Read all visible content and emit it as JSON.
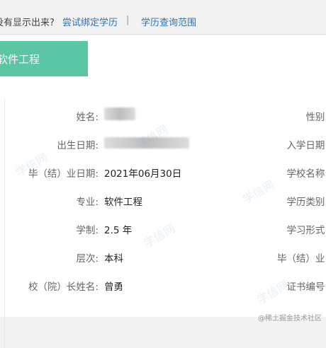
{
  "topbar": {
    "question": "没有显示出来?",
    "link_bind": "尝试绑定学历",
    "separator": "|",
    "link_query": "学历查询范围"
  },
  "tab": {
    "label": "软件工程"
  },
  "left_rows": [
    {
      "label": "姓名:",
      "value": ""
    },
    {
      "label": "出生日期:",
      "value": ""
    },
    {
      "label": "毕（结）业日期:",
      "value": "2021年06月30日"
    },
    {
      "label": "专业:",
      "value": "软件工程"
    },
    {
      "label": "学制:",
      "value": "2.5 年"
    },
    {
      "label": "层次:",
      "value": "本科"
    },
    {
      "label": "校（院）长姓名:",
      "value": "曾勇"
    }
  ],
  "right_rows": [
    {
      "label": "性别:"
    },
    {
      "label": "入学日期:"
    },
    {
      "label": "学校名称:"
    },
    {
      "label": "学历类别:"
    },
    {
      "label": "学习形式:"
    },
    {
      "label": "毕（结）业:"
    },
    {
      "label": "证书编号:"
    }
  ],
  "watermark": {
    "text": "学信网"
  },
  "footer": {
    "credit": "@稀土掘金技术社区"
  }
}
